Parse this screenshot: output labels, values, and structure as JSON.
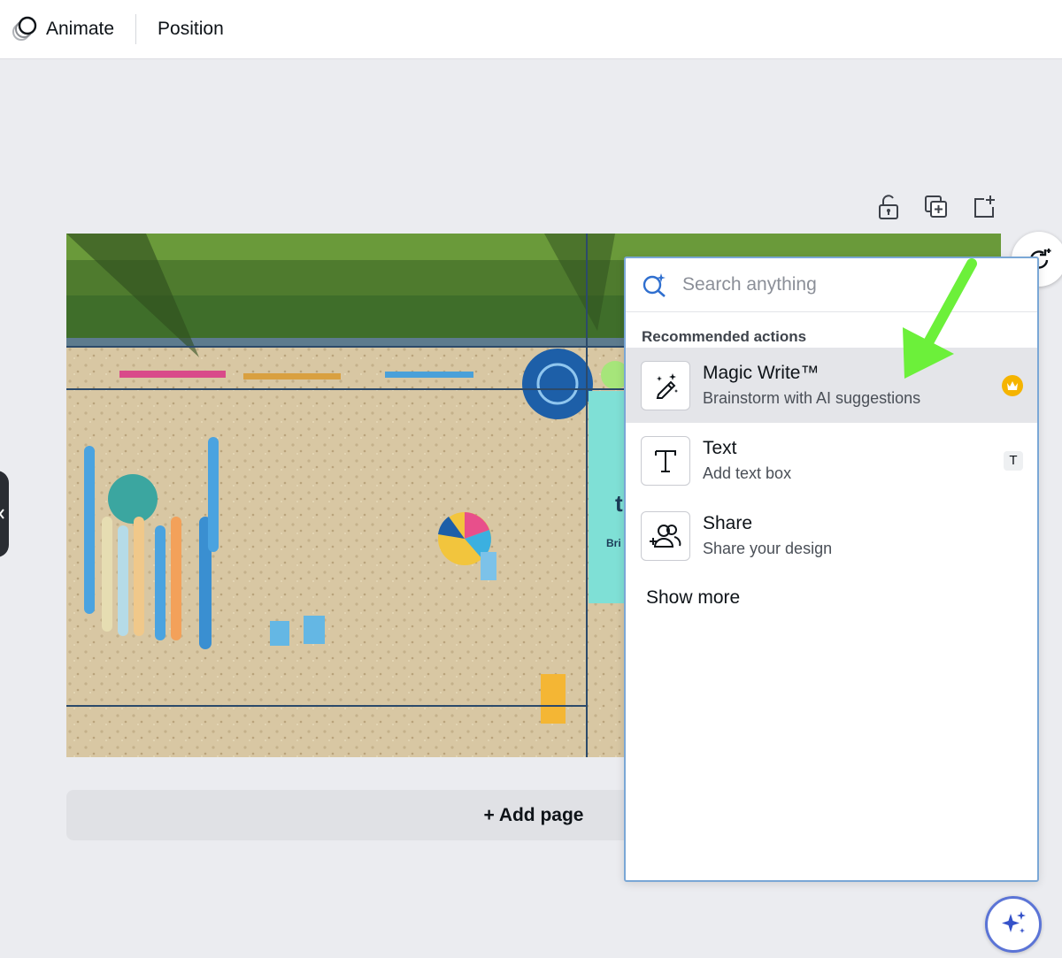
{
  "topbar": {
    "animate_label": "Animate",
    "position_label": "Position"
  },
  "page_tools": {
    "icons": [
      "lock-icon",
      "duplicate-page-icon",
      "add-page-icon"
    ]
  },
  "add_page": {
    "label": "+ Add page"
  },
  "canvas": {
    "design_partial_text_1": "t",
    "design_partial_text_2": "Bri"
  },
  "quick_actions": {
    "search_placeholder": "Search anything",
    "section_title": "Recommended actions",
    "items": [
      {
        "title": "Magic Write™",
        "subtitle": "Brainstorm with AI suggestions",
        "icon": "magic-pen-icon",
        "badge": "crown-icon"
      },
      {
        "title": "Text",
        "subtitle": "Add text box",
        "icon": "text-icon",
        "shortcut": "T"
      },
      {
        "title": "Share",
        "subtitle": "Share your design",
        "icon": "share-people-icon"
      }
    ],
    "show_more_label": "Show more"
  },
  "colors": {
    "panel_border": "#7aa7d6",
    "accent_arrow": "#6cf03a",
    "crown": "#f5b400",
    "teal_card": "#7fe0d6"
  }
}
